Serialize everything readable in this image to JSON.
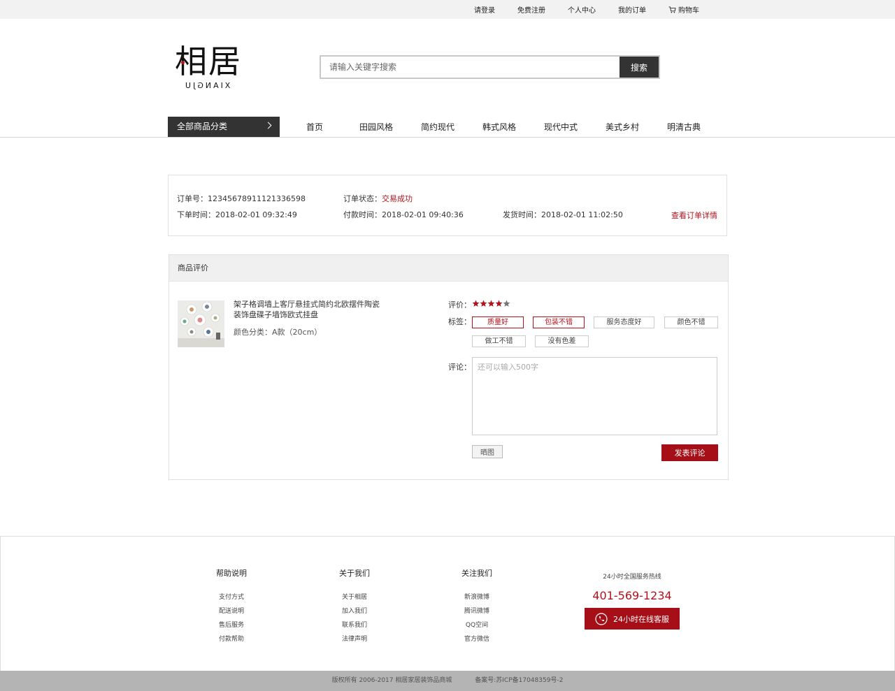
{
  "topbar": {
    "login": "请登录",
    "register": "免费注册",
    "account": "个人中心",
    "orders": "我的订单",
    "cart": "购物车"
  },
  "logo": {
    "cn": "相居",
    "en": "XIANGJU"
  },
  "search": {
    "placeholder": "请输入关键字搜索",
    "button": "搜索"
  },
  "nav": {
    "all_categories": "全部商品分类",
    "items": [
      "首页",
      "田园风格",
      "简约现代",
      "韩式风格",
      "现代中式",
      "美式乡村",
      "明清古典"
    ]
  },
  "order": {
    "number_label": "订单号：",
    "number": "12345678911121336598",
    "status_label": "订单状态：",
    "status": "交易成功",
    "order_time_label": "下单时间：",
    "order_time": "2018-02-01 09:32:49",
    "pay_time_label": "付款时间：",
    "pay_time": "2018-02-01 09:40:36",
    "ship_time_label": "发货时间：",
    "ship_time": "2018-02-01 11:02:50",
    "detail_link": "查看订单详情"
  },
  "review": {
    "title": "商品评价",
    "product_name": "架子格调墙上客厅悬挂式简约北欧摆件陶瓷装饰盘碟子墙饰欧式挂盘",
    "product_color": "颜色分类：A款（20cm）",
    "rating_label": "评价：",
    "rating": 4,
    "rating_max": 5,
    "tags_label": "标签：",
    "tags": [
      {
        "text": "质量好",
        "selected": true
      },
      {
        "text": "包装不错",
        "selected": true
      },
      {
        "text": "服务态度好",
        "selected": false
      },
      {
        "text": "颜色不错",
        "selected": false
      },
      {
        "text": "做工不错",
        "selected": false
      },
      {
        "text": "没有色差",
        "selected": false
      }
    ],
    "comment_label": "评论：",
    "comment_placeholder": "还可以输入500字",
    "photo_button": "晒图",
    "submit_button": "发表评论"
  },
  "footer": {
    "columns": [
      {
        "title": "帮助说明",
        "links": [
          "支付方式",
          "配送说明",
          "售后服务",
          "付款帮助"
        ]
      },
      {
        "title": "关于我们",
        "links": [
          "关于相居",
          "加入我们",
          "联系我们",
          "法律声明"
        ]
      },
      {
        "title": "关注我们",
        "links": [
          "新浪微博",
          "腾讯微博",
          "QQ空间",
          "官方微信"
        ]
      }
    ],
    "hotline_caption": "24小时全国服务热线",
    "hotline_number": "401-569-1234",
    "service_button": "24小时在线客服"
  },
  "copyright": {
    "text": "版权所有 2006-2017 相居家居装饰品商城",
    "icp": "备案号:苏ICP备17048359号-2"
  },
  "colors": {
    "accent": "#b5121b",
    "dark": "#333333",
    "star_empty": "#777777"
  },
  "icons": {
    "cart": "cart-icon",
    "chevron": "chevron-right-icon",
    "star": "star-icon",
    "phone": "phone-icon"
  }
}
